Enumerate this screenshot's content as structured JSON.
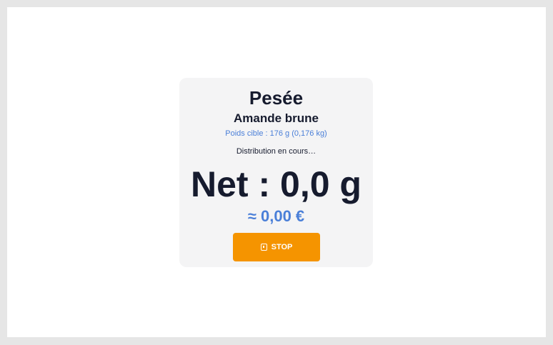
{
  "weighing": {
    "title": "Pesée",
    "product": "Amande brune",
    "target_weight": "Poids cible : 176 g (0,176 kg)",
    "status": "Distribution en cours…",
    "net_weight": "Net : 0,0 g",
    "price": "≈ 0,00 €",
    "stop_label": "STOP",
    "stop_icon": "stop-icon"
  },
  "colors": {
    "accent_blue": "#4a7fd8",
    "button_orange": "#f59400",
    "text_dark": "#161b2e",
    "card_bg": "#f4f4f5"
  }
}
